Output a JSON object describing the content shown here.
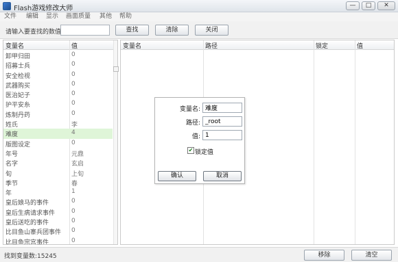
{
  "window": {
    "title": "Flash游戏修改大师",
    "minimize_glyph": "—",
    "maximize_glyph": "□",
    "close_glyph": "✕"
  },
  "menu": [
    "文件",
    "编辑",
    "显示",
    "画面质量",
    "其他",
    "帮助"
  ],
  "toolbar": {
    "search_label": "请输入要查找的数值",
    "search_value": "",
    "find_label": "查找",
    "clear_label": "清除",
    "close_label": "关闭"
  },
  "left_table": {
    "headers": [
      "变量名",
      "值"
    ],
    "rows": [
      {
        "name": "卸甲归田",
        "value": "0"
      },
      {
        "name": "招募士兵",
        "value": "0"
      },
      {
        "name": "安全检视",
        "value": "0"
      },
      {
        "name": "武器购买",
        "value": "0"
      },
      {
        "name": "医治妃子",
        "value": "0"
      },
      {
        "name": "护平安糸",
        "value": "0"
      },
      {
        "name": "炼制丹药",
        "value": "0"
      },
      {
        "name": "姓氏",
        "value": "李"
      },
      {
        "name": "难度",
        "value": "4"
      },
      {
        "name": "版图设定",
        "value": "0"
      },
      {
        "name": "年号",
        "value": "元鼎"
      },
      {
        "name": "名字",
        "value": "玄启"
      },
      {
        "name": "旬",
        "value": "上旬"
      },
      {
        "name": "季节",
        "value": "春"
      },
      {
        "name": "年",
        "value": "1"
      },
      {
        "name": "皇后娘马的事件",
        "value": "0"
      },
      {
        "name": "皇后生病请求事件",
        "value": "0"
      },
      {
        "name": "皇后送吃的事件",
        "value": "0"
      },
      {
        "name": "比目鱼山寨兵团事件",
        "value": "0"
      },
      {
        "name": "比目鱼宗宫事件",
        "value": "0"
      }
    ],
    "selected_index": 8
  },
  "right_table": {
    "headers": [
      "变量名",
      "路径",
      "锁定",
      "值"
    ]
  },
  "dialog": {
    "var_label": "变量名:",
    "var_value": "难度",
    "path_label": "路径:",
    "path_value": "_root",
    "value_label": "值:",
    "value_value": "1",
    "lock_label": "锁定值",
    "lock_checked": true,
    "ok_label": "确认",
    "cancel_label": "取消"
  },
  "status": {
    "text": "找到变量数:15245",
    "remove_label": "移除",
    "clear_label": "清空"
  }
}
